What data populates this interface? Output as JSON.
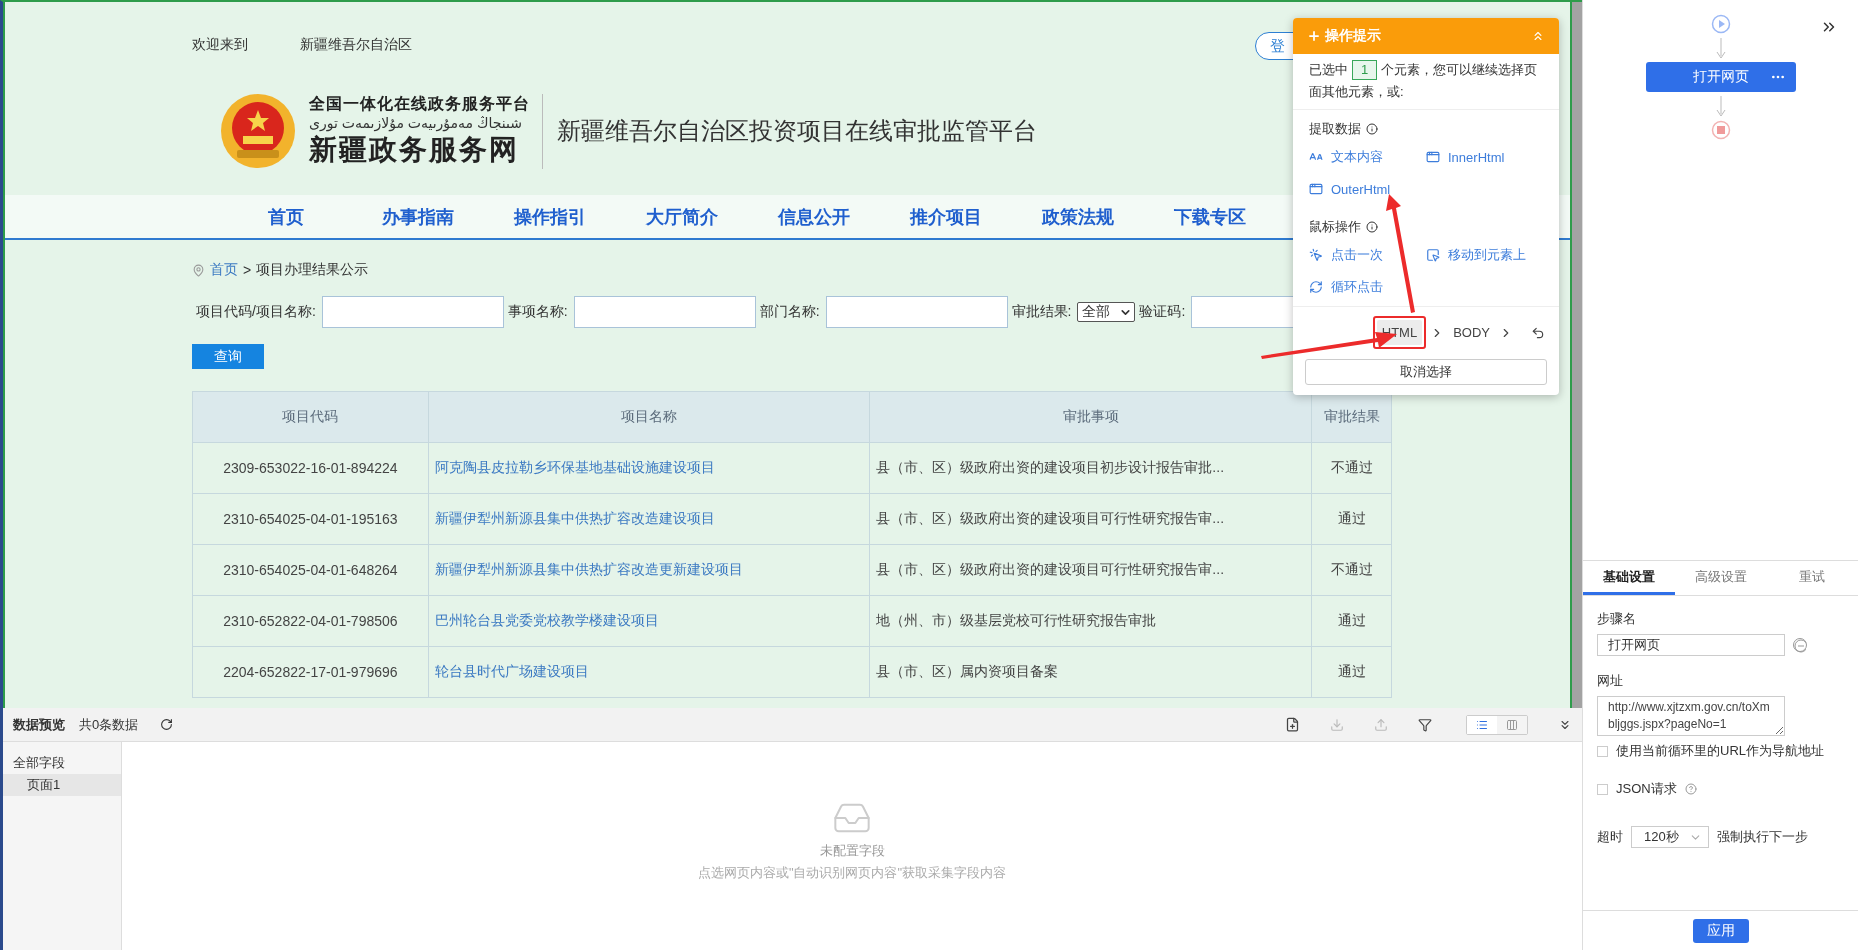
{
  "site": {
    "welcome": "欢迎来到",
    "region": "新疆维吾尔自治区",
    "login": "登",
    "logo_title": "全国一体化在线政务服务平台",
    "logo_uyghur": "شىنجاڭ مەمۇرىيەت مۇلازىمەت تورى",
    "logo_name": "新疆政务服务网",
    "platform": "新疆维吾尔自治区投资项目在线审批监管平台"
  },
  "nav": [
    {
      "label": "首页"
    },
    {
      "label": "办事指南"
    },
    {
      "label": "操作指引"
    },
    {
      "label": "大厅简介"
    },
    {
      "label": "信息公开"
    },
    {
      "label": "推介项目"
    },
    {
      "label": "政策法规"
    },
    {
      "label": "下载专区"
    }
  ],
  "breadcrumb": {
    "home": "首页",
    "separator": ">",
    "current": "项目办理结果公示"
  },
  "search": {
    "fields": [
      {
        "label": "项目代码/项目名称:",
        "kind": "text"
      },
      {
        "label": "事项名称:",
        "kind": "text"
      },
      {
        "label": "部门名称:",
        "kind": "text"
      },
      {
        "label": "审批结果:",
        "kind": "select",
        "value": "全部"
      },
      {
        "label": "验证码:",
        "kind": "text"
      }
    ],
    "button": "查询"
  },
  "table": {
    "columns": [
      "项目代码",
      "项目名称",
      "审批事项",
      "审批结果"
    ],
    "rows": [
      {
        "code": "2309-653022-16-01-894224",
        "name": "阿克陶县皮拉勒乡环保基地基础设施建设项目",
        "item": "县（市、区）级政府出资的建设项目初步设计报告审批...",
        "result": "不通过"
      },
      {
        "code": "2310-654025-04-01-195163",
        "name": "新疆伊犁州新源县集中供热扩容改造建设项目",
        "item": "县（市、区）级政府出资的建设项目可行性研究报告审...",
        "result": "通过"
      },
      {
        "code": "2310-654025-04-01-648264",
        "name": "新疆伊犁州新源县集中供热扩容改造更新建设项目",
        "item": "县（市、区）级政府出资的建设项目可行性研究报告审...",
        "result": "不通过"
      },
      {
        "code": "2310-652822-04-01-798506",
        "name": "巴州轮台县党委党校教学楼建设项目",
        "item": "地（州、市）级基层党校可行性研究报告审批",
        "result": "通过"
      },
      {
        "code": "2204-652822-17-01-979696",
        "name": "轮台县时代广场建设项目",
        "item": "县（市、区）属内资项目备案",
        "result": "通过"
      }
    ]
  },
  "popup": {
    "title": "操作提示",
    "expanded": true,
    "selected_prefix": "已选中",
    "selected_count": "1",
    "selected_suffix": "个元素，您可以继续选择页面其他元素，或:",
    "sections": [
      {
        "title": "提取数据",
        "actions": [
          {
            "label": "文本内容",
            "kind": "text"
          },
          {
            "label": "InnerHtml",
            "kind": "html"
          },
          {
            "label": "OuterHtml",
            "kind": "html"
          }
        ]
      },
      {
        "title": "鼠标操作",
        "actions": [
          {
            "label": "点击一次",
            "kind": "click"
          },
          {
            "label": "移动到元素上",
            "kind": "hover"
          },
          {
            "label": "循环点击",
            "kind": "loop"
          }
        ]
      }
    ],
    "path": [
      {
        "label": "HTML",
        "selected": true
      },
      {
        "label": "BODY",
        "selected": false
      }
    ],
    "cancel": "取消选择"
  },
  "flow": {
    "step": "打开网页"
  },
  "settings": {
    "tabs": [
      {
        "label": "基础设置",
        "selected": true
      },
      {
        "label": "高级设置",
        "selected": false
      },
      {
        "label": "重试",
        "selected": false
      }
    ],
    "step_label": "步骤名",
    "step_value": "打开网页",
    "url_label": "网址",
    "url_value": "http://www.xjtzxm.gov.cn/toXmbljggs.jspx?pageNo=1",
    "checks": [
      {
        "label": "使用当前循环里的URL作为导航地址",
        "checked": false,
        "help": false
      },
      {
        "label": "JSON请求",
        "checked": false,
        "help": true
      }
    ],
    "timeout_label": "超时",
    "timeout_value": "120秒",
    "timeout_hint": "强制执行下一步",
    "apply": "应用"
  },
  "preview": {
    "title": "数据预览",
    "count": "共0条数据",
    "view": [
      {
        "kind": "list",
        "selected": true
      },
      {
        "kind": "columns",
        "selected": false
      }
    ],
    "tree": {
      "label": "全部字段",
      "children": [
        {
          "label": "页面1",
          "selected": true
        }
      ]
    },
    "empty_title": "未配置字段",
    "empty_hint": "点选网页内容或\"自动识别网页内容\"获取采集字段内容"
  }
}
